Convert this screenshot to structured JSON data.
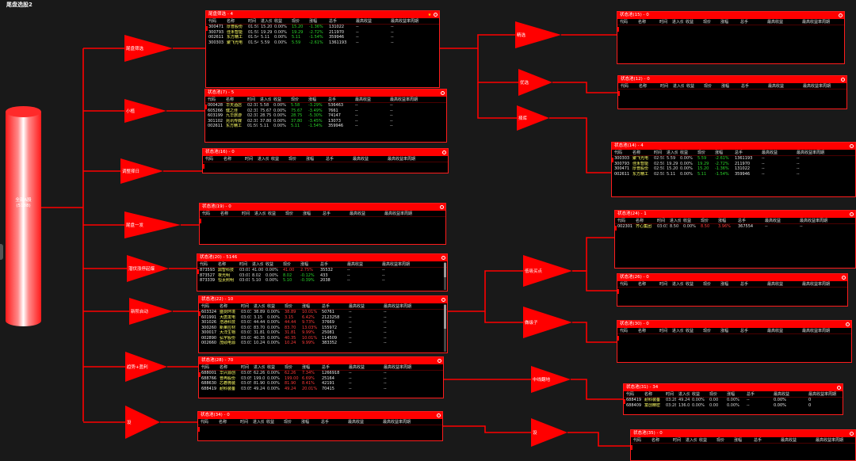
{
  "app": {
    "title": "尾盘选股2"
  },
  "root": {
    "label": "全部A股",
    "count": "(5188)"
  },
  "columns": [
    "代码",
    "名称",
    "时间",
    "进入价",
    "收益",
    "现价",
    "涨幅",
    "总手",
    "最高收益",
    "最高收益率周期"
  ],
  "branches": [
    {
      "label": "尾盘筛选"
    },
    {
      "label": "小植"
    },
    {
      "label": "调整择日"
    },
    {
      "label": "尾盘一发"
    },
    {
      "label": "潜伏涨停起爆"
    },
    {
      "label": "新阶启动"
    },
    {
      "label": "趋势+盈利"
    },
    {
      "label": "设"
    }
  ],
  "level2": [
    {
      "label": "精选"
    },
    {
      "label": "优选"
    },
    {
      "label": "择库"
    },
    {
      "label": "低吸买点"
    },
    {
      "label": "做级子"
    },
    {
      "label": "中线翻地"
    },
    {
      "label": "设"
    }
  ],
  "panels": [
    {
      "title": "尾盘筛选 - 4",
      "icons": [
        "star",
        "gear"
      ],
      "rows": [
        {
          "code": "300471",
          "name": "厚普股份",
          "time": "01:59",
          "price": "15.20",
          "ret": "0.00%",
          "cur": "15.20",
          "chg": "-1.36%",
          "vol": "131022",
          "hi": "--",
          "hip": "--",
          "dir": "dn"
        },
        {
          "code": "300793",
          "name": "佳禾智能",
          "time": "01:59",
          "price": "19.29",
          "ret": "0.00%",
          "cur": "19.29",
          "chg": "-2.72%",
          "vol": "211970",
          "hi": "--",
          "hip": "--",
          "dir": "dn"
        },
        {
          "code": "002611",
          "name": "东方精工",
          "time": "01:54",
          "price": "5.11",
          "ret": "0.00%",
          "cur": "5.11",
          "chg": "-1.54%",
          "vol": "359946",
          "hi": "--",
          "hip": "--",
          "dir": "dn"
        },
        {
          "code": "300303",
          "name": "聚飞光电",
          "time": "01:54",
          "price": "5.59",
          "ret": "0.00%",
          "cur": "5.59",
          "chg": "-2.61%",
          "vol": "1361193",
          "hi": "--",
          "hip": "--",
          "dir": "dn"
        }
      ]
    },
    {
      "title": "状态池(7) - 5",
      "icons": [
        "gear"
      ],
      "rows": [
        {
          "code": "000428",
          "name": "华天酒店",
          "time": "02:31",
          "price": "5.58",
          "ret": "0.00%",
          "cur": "5.58",
          "chg": "-3.29%",
          "vol": "536463",
          "hi": "--",
          "hip": "--",
          "dir": "dn"
        },
        {
          "code": "605266",
          "name": "健之佳",
          "time": "02:31",
          "price": "75.67",
          "ret": "0.00%",
          "cur": "75.67",
          "chg": "-3.49%",
          "vol": "7661",
          "hi": "--",
          "hip": "--",
          "dir": "dn"
        },
        {
          "code": "603199",
          "name": "九华旅游",
          "time": "02:31",
          "price": "28.75",
          "ret": "0.00%",
          "cur": "28.75",
          "chg": "-5.30%",
          "vol": "74147",
          "hi": "--",
          "hip": "--",
          "dir": "dn"
        },
        {
          "code": "301102",
          "name": "兆讯传媒",
          "time": "02:31",
          "price": "37.80",
          "ret": "0.00%",
          "cur": "37.80",
          "chg": "-3.45%",
          "vol": "13073",
          "hi": "--",
          "hip": "--",
          "dir": "dn"
        },
        {
          "code": "002611",
          "name": "东方精工",
          "time": "01:59",
          "price": "5.11",
          "ret": "0.00%",
          "cur": "5.11",
          "chg": "-1.54%",
          "vol": "359946",
          "hi": "--",
          "hip": "--",
          "dir": "dn"
        }
      ]
    },
    {
      "title": "状态池(16) - 0",
      "icons": [
        "gear"
      ],
      "rows": []
    },
    {
      "title": "状态池(19) - 0",
      "icons": [
        "gear"
      ],
      "rows": []
    },
    {
      "title": "状态池(20) - 5146",
      "icons": [
        "gear"
      ],
      "rows": [
        {
          "code": "873593",
          "name": "鼎智科技",
          "time": "03:01",
          "price": "41.00",
          "ret": "0.00%",
          "cur": "41.00",
          "chg": "2.75%",
          "vol": "35532",
          "hi": "--",
          "hip": "--",
          "dir": "up"
        },
        {
          "code": "873527",
          "name": "夜光明",
          "time": "03:01",
          "price": "8.02",
          "ret": "0.00%",
          "cur": "8.02",
          "chg": "-0.12%",
          "vol": "433",
          "hi": "--",
          "hip": "--",
          "dir": "dn"
        },
        {
          "code": "873339",
          "name": "恒太照明",
          "time": "03:01",
          "price": "5.10",
          "ret": "0.00%",
          "cur": "5.10",
          "chg": "-0.39%",
          "vol": "2038",
          "hi": "--",
          "hip": "--",
          "dir": "dn"
        }
      ]
    },
    {
      "title": "状态池(22) - 10",
      "icons": [
        "gear"
      ],
      "rows": [
        {
          "code": "603324",
          "name": "盛剑环境",
          "time": "03:03",
          "price": "38.89",
          "ret": "0.00%",
          "cur": "38.89",
          "chg": "10.01%",
          "vol": "50761",
          "hi": "--",
          "hip": "--",
          "dir": "up"
        },
        {
          "code": "601991",
          "name": "大唐发电",
          "time": "03:03",
          "price": "3.15",
          "ret": "0.00%",
          "cur": "3.15",
          "chg": "6.42%",
          "vol": "2123258",
          "hi": "--",
          "hip": "--",
          "dir": "up"
        },
        {
          "code": "301026",
          "name": "浩通科技",
          "time": "03:03",
          "price": "44.44",
          "ret": "0.00%",
          "cur": "44.44",
          "chg": "9.73%",
          "vol": "37669",
          "hi": "--",
          "hip": "--",
          "dir": "up"
        },
        {
          "code": "300260",
          "name": "新莱应材",
          "time": "03:03",
          "price": "83.70",
          "ret": "0.00%",
          "cur": "83.70",
          "chg": "13.03%",
          "vol": "155972",
          "hi": "--",
          "hip": "--",
          "dir": "up"
        },
        {
          "code": "300017",
          "name": "大洋生物",
          "time": "03:03",
          "price": "31.81",
          "ret": "0.00%",
          "cur": "31.81",
          "chg": "9.99%",
          "vol": "25081",
          "hi": "--",
          "hip": "--",
          "dir": "up"
        },
        {
          "code": "002890",
          "name": "弘宇股份",
          "time": "03:03",
          "price": "40.35",
          "ret": "0.00%",
          "cur": "40.35",
          "chg": "10.01%",
          "vol": "114509",
          "hi": "--",
          "hip": "--",
          "dir": "up"
        },
        {
          "code": "002660",
          "name": "茂硕电源",
          "time": "03:03",
          "price": "10.24",
          "ret": "0.00%",
          "cur": "10.24",
          "chg": "9.99%",
          "vol": "383352",
          "hi": "--",
          "hip": "--",
          "dir": "up"
        }
      ]
    },
    {
      "title": "状态池(28) - 70",
      "icons": [
        "gear"
      ],
      "rows": [
        {
          "code": "688001",
          "name": "华兴源创",
          "time": "03:05",
          "price": "62.26",
          "ret": "0.00%",
          "cur": "62.26",
          "chg": "7.34%",
          "vol": "1266918",
          "hi": "--",
          "hip": "--",
          "dir": "up"
        },
        {
          "code": "688766",
          "name": "普冉股份",
          "time": "03:05",
          "price": "199.00",
          "ret": "0.00%",
          "cur": "199.00",
          "chg": "6.69%",
          "vol": "25164",
          "hi": "--",
          "hip": "--",
          "dir": "up"
        },
        {
          "code": "688630",
          "name": "芯碁微装",
          "time": "03:05",
          "price": "81.90",
          "ret": "0.00%",
          "cur": "81.90",
          "chg": "8.41%",
          "vol": "42191",
          "hi": "--",
          "hip": "--",
          "dir": "up"
        },
        {
          "code": "688419",
          "name": "耐科装备",
          "time": "03:05",
          "price": "49.24",
          "ret": "0.00%",
          "cur": "49.24",
          "chg": "20.01%",
          "vol": "70415",
          "hi": "--",
          "hip": "--",
          "dir": "up"
        }
      ]
    },
    {
      "title": "状态池(34) - 0",
      "icons": [
        "gear"
      ],
      "rows": []
    },
    {
      "title": "状态池(15) - 0",
      "icons": [
        "gear"
      ],
      "rows": []
    },
    {
      "title": "状态池(12) - 0",
      "icons": [
        "gear"
      ],
      "rows": []
    },
    {
      "title": "状态池(14) - 4",
      "icons": [
        "gear"
      ],
      "rows": [
        {
          "code": "300303",
          "name": "聚飞光电",
          "time": "02:59",
          "price": "5.59",
          "ret": "0.00%",
          "cur": "5.59",
          "chg": "-2.61%",
          "vol": "1361193",
          "hi": "--",
          "hip": "--",
          "dir": "dn"
        },
        {
          "code": "300793",
          "name": "佳禾智能",
          "time": "02:59",
          "price": "19.29",
          "ret": "0.00%",
          "cur": "19.29",
          "chg": "-2.72%",
          "vol": "211970",
          "hi": "--",
          "hip": "--",
          "dir": "dn"
        },
        {
          "code": "300471",
          "name": "厚普股份",
          "time": "02:59",
          "price": "15.20",
          "ret": "0.00%",
          "cur": "15.20",
          "chg": "-1.36%",
          "vol": "131022",
          "hi": "--",
          "hip": "--",
          "dir": "dn"
        },
        {
          "code": "002611",
          "name": "东方精工",
          "time": "02:59",
          "price": "5.11",
          "ret": "0.00%",
          "cur": "5.11",
          "chg": "-1.54%",
          "vol": "359946",
          "hi": "--",
          "hip": "--",
          "dir": "dn"
        }
      ]
    },
    {
      "title": "状态池(24) - 1",
      "icons": [
        "gear"
      ],
      "rows": [
        {
          "code": "002301",
          "name": "齐心集团",
          "time": "03:03",
          "price": "8.50",
          "ret": "0.00%",
          "cur": "8.50",
          "chg": "3.96%",
          "vol": "367554",
          "hi": "--",
          "hip": "--",
          "dir": "up"
        }
      ]
    },
    {
      "title": "状态池(26) - 0",
      "icons": [
        "gear"
      ],
      "rows": []
    },
    {
      "title": "状态池(30) - 0",
      "icons": [
        "gear"
      ],
      "rows": []
    },
    {
      "title": "状态池(31) - 34",
      "icons": [
        "gear"
      ],
      "rows": [
        {
          "code": "688419",
          "name": "耐科装备",
          "time": "03:28",
          "price": "49.24",
          "ret": "0.00%",
          "cur": "0.00",
          "chg": "0.00%",
          "vol": "--",
          "hi": "0.00%",
          "hip": "0",
          "dir": "flat"
        },
        {
          "code": "688409",
          "name": "富创精密",
          "time": "03:28",
          "price": "136.00",
          "ret": "0.00%",
          "cur": "0.00",
          "chg": "0.00%",
          "vol": "--",
          "hi": "0.00%",
          "hip": "0",
          "dir": "flat"
        }
      ]
    },
    {
      "title": "状态池(35) - 0",
      "icons": [
        "gear"
      ],
      "rows": []
    }
  ]
}
